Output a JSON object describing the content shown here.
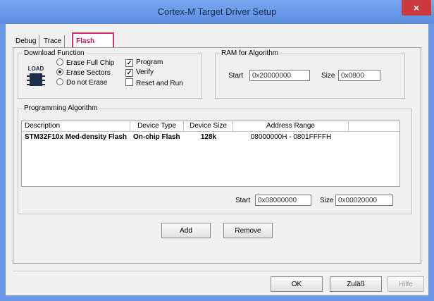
{
  "window": {
    "title": "Cortex-M Target Driver Setup",
    "close_label": "×"
  },
  "tabs": [
    {
      "label": "Debug"
    },
    {
      "label": "Trace"
    },
    {
      "label": "Flash Download"
    }
  ],
  "download_function": {
    "title": "Download Function",
    "icon": "load-chip-icon",
    "icon_text": "LOAD",
    "radios": [
      {
        "label": "Erase Full Chip",
        "selected": false
      },
      {
        "label": "Erase Sectors",
        "selected": true
      },
      {
        "label": "Do not Erase",
        "selected": false
      }
    ],
    "checks": [
      {
        "label": "Program",
        "checked": true
      },
      {
        "label": "Verify",
        "checked": true
      },
      {
        "label": "Reset and Run",
        "checked": false
      }
    ]
  },
  "ram": {
    "title": "RAM for Algorithm",
    "start_label": "Start",
    "start_value": "0x20000000",
    "size_label": "Size",
    "size_value": "0x0800"
  },
  "algorithm": {
    "title": "Programming Algorithm",
    "columns": [
      "Description",
      "Device Type",
      "Device Size",
      "Address Range"
    ],
    "rows": [
      [
        "STM32F10x Med-density Flash",
        "On-chip Flash",
        "128k",
        "08000000H - 0801FFFFH"
      ]
    ],
    "start_label": "Start",
    "start_value": "0x08000000",
    "size_label": "Size",
    "size_value": "0x00020000",
    "add_label": "Add",
    "remove_label": "Remove"
  },
  "footer": {
    "ok_label": "OK",
    "cancel_label": "Zuläß",
    "help_label": "Hilfe"
  },
  "colors": {
    "accent": "#d7316e",
    "titlebar": "#6a97e8",
    "close": "#c9393d"
  }
}
